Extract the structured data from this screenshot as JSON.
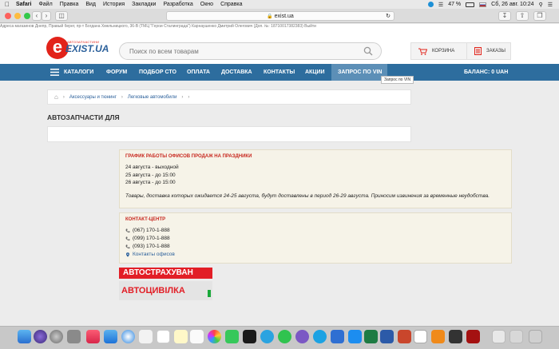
{
  "menubar": {
    "app": "Safari",
    "items": [
      "Файл",
      "Правка",
      "Вид",
      "История",
      "Закладки",
      "Разработка",
      "Окно",
      "Справка"
    ],
    "battery": "47 %",
    "datetime": "Сб, 26 авг.  10:24"
  },
  "browser": {
    "url": "exist.ua"
  },
  "site": {
    "top_strip": "Адреса магазинов   Днепр, Правый берег, пр-т Богдана Хмельницкого, 36-В (ТМЦ \"Герои Сталинграда\")          Карнаушенко Дмитрий Олегович (Доп. №: 18710017382383)    Выйти",
    "logo_small": "АВТОЗАПЧАСТИНИ",
    "logo_big": "EXIST.UA",
    "search_placeholder": "Поиск по всем товарам",
    "cart_label": "КОРЗИНА",
    "orders_label": "ЗАКАЗЫ",
    "nav": [
      "КАТАЛОГИ",
      "ФОРУМ",
      "ПОДБОР СТО",
      "ОПЛАТА",
      "ДОСТАВКА",
      "КОНТАКТЫ",
      "АКЦИИ",
      "ЗАПРОС ПО VIN"
    ],
    "balance": "БАЛАНС: 0 UAH",
    "tooltip": "Запрос по VIN",
    "breadcrumb": [
      "Аксессуары и тюнинг",
      "Легковые автомобили"
    ],
    "page_title": "АВТОЗАПЧАСТИ ДЛЯ"
  },
  "holiday_notice": {
    "heading": "ГРАФИК РАБОТЫ ОФИСОВ ПРОДАЖ НА ПРАЗДНИКИ",
    "lines": [
      "24 августа - выходной",
      "25 августа - до 15:00",
      "26 августа - до 15:00"
    ],
    "note": "Товары, доставка которых ожидается 24-25 августа, будут доставлены в период 26-29 августа. Приносим извинения за временные неудобства."
  },
  "contact_center": {
    "heading": "КОНТАКТ-ЦЕНТР",
    "phones": [
      "(067) 170-1-888",
      "(099) 170-1-888",
      "(093) 170-1-888"
    ],
    "offices_link": "Контакты офисов"
  },
  "banner": {
    "line1": "АВТОСТРАХУВАН",
    "line2": "АВТОЦИВІЛКА"
  },
  "colors": {
    "nav_bg": "#2d6d9e",
    "accent_red": "#e2231a",
    "notice_bg": "#f6f3e8"
  }
}
